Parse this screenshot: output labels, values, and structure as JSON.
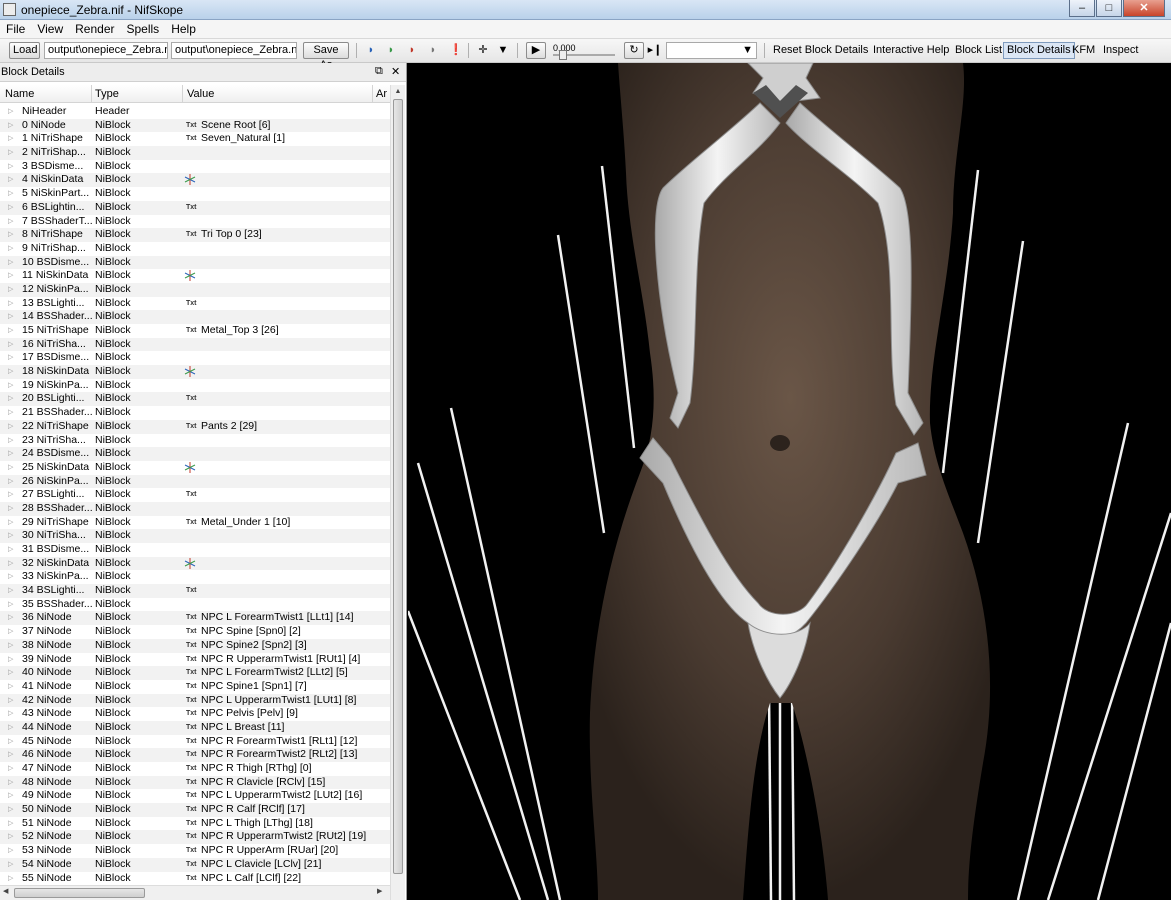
{
  "window": {
    "title": "onepiece_Zebra.nif - NifSkope",
    "min": "–",
    "max": "□",
    "close": "✕"
  },
  "menu": {
    "file": "File",
    "view": "View",
    "render": "Render",
    "spells": "Spells",
    "help": "Help"
  },
  "toolbar": {
    "load": "Load",
    "load_path": "output\\onepiece_Zebra.nif",
    "save_path": "output\\onepiece_Zebra.nif",
    "save_as": "Save As",
    "time_value": "0.000",
    "reset_block_details": "Reset Block Details",
    "interactive_help": "Interactive Help",
    "block_list": "Block List",
    "block_details": "Block Details",
    "kfm": "KFM",
    "inspect": "Inspect"
  },
  "block_details": {
    "title": "Block Details",
    "columns": {
      "name": "Name",
      "type": "Type",
      "value": "Value",
      "args": "Ar"
    },
    "rows": [
      {
        "name": "NiHeader",
        "type": "Header",
        "value": "",
        "tag": ""
      },
      {
        "name": "0 NiNode",
        "type": "NiBlock",
        "value": "Scene Root [6]",
        "tag": "Txt"
      },
      {
        "name": "1 NiTriShape",
        "type": "NiBlock",
        "value": "Seven_Natural [1]",
        "tag": "Txt"
      },
      {
        "name": "2 NiTriShap...",
        "type": "NiBlock",
        "value": "",
        "tag": ""
      },
      {
        "name": "3 BSDisme...",
        "type": "NiBlock",
        "value": "",
        "tag": ""
      },
      {
        "name": "4 NiSkinData",
        "type": "NiBlock",
        "value": "",
        "tag": "star"
      },
      {
        "name": "5 NiSkinPart...",
        "type": "NiBlock",
        "value": "",
        "tag": ""
      },
      {
        "name": "6 BSLightin...",
        "type": "NiBlock",
        "value": "",
        "tag": "Txt"
      },
      {
        "name": "7 BSShaderT...",
        "type": "NiBlock",
        "value": "",
        "tag": ""
      },
      {
        "name": "8 NiTriShape",
        "type": "NiBlock",
        "value": "Tri Top 0 [23]",
        "tag": "Txt"
      },
      {
        "name": "9 NiTriShap...",
        "type": "NiBlock",
        "value": "",
        "tag": ""
      },
      {
        "name": "10 BSDisme...",
        "type": "NiBlock",
        "value": "",
        "tag": ""
      },
      {
        "name": "11 NiSkinData",
        "type": "NiBlock",
        "value": "",
        "tag": "star"
      },
      {
        "name": "12 NiSkinPa...",
        "type": "NiBlock",
        "value": "",
        "tag": ""
      },
      {
        "name": "13 BSLighti...",
        "type": "NiBlock",
        "value": "",
        "tag": "Txt"
      },
      {
        "name": "14 BSShader...",
        "type": "NiBlock",
        "value": "",
        "tag": ""
      },
      {
        "name": "15 NiTriShape",
        "type": "NiBlock",
        "value": "Metal_Top 3 [26]",
        "tag": "Txt"
      },
      {
        "name": "16 NiTriSha...",
        "type": "NiBlock",
        "value": "",
        "tag": ""
      },
      {
        "name": "17 BSDisme...",
        "type": "NiBlock",
        "value": "",
        "tag": ""
      },
      {
        "name": "18 NiSkinData",
        "type": "NiBlock",
        "value": "",
        "tag": "star"
      },
      {
        "name": "19 NiSkinPa...",
        "type": "NiBlock",
        "value": "",
        "tag": ""
      },
      {
        "name": "20 BSLighti...",
        "type": "NiBlock",
        "value": "",
        "tag": "Txt"
      },
      {
        "name": "21 BSShader...",
        "type": "NiBlock",
        "value": "",
        "tag": ""
      },
      {
        "name": "22 NiTriShape",
        "type": "NiBlock",
        "value": "Pants 2 [29]",
        "tag": "Txt"
      },
      {
        "name": "23 NiTriSha...",
        "type": "NiBlock",
        "value": "",
        "tag": ""
      },
      {
        "name": "24 BSDisme...",
        "type": "NiBlock",
        "value": "",
        "tag": ""
      },
      {
        "name": "25 NiSkinData",
        "type": "NiBlock",
        "value": "",
        "tag": "star"
      },
      {
        "name": "26 NiSkinPa...",
        "type": "NiBlock",
        "value": "",
        "tag": ""
      },
      {
        "name": "27 BSLighti...",
        "type": "NiBlock",
        "value": "",
        "tag": "Txt"
      },
      {
        "name": "28 BSShader...",
        "type": "NiBlock",
        "value": "",
        "tag": ""
      },
      {
        "name": "29 NiTriShape",
        "type": "NiBlock",
        "value": "Metal_Under 1 [10]",
        "tag": "Txt"
      },
      {
        "name": "30 NiTriSha...",
        "type": "NiBlock",
        "value": "",
        "tag": ""
      },
      {
        "name": "31 BSDisme...",
        "type": "NiBlock",
        "value": "",
        "tag": ""
      },
      {
        "name": "32 NiSkinData",
        "type": "NiBlock",
        "value": "",
        "tag": "star"
      },
      {
        "name": "33 NiSkinPa...",
        "type": "NiBlock",
        "value": "",
        "tag": ""
      },
      {
        "name": "34 BSLighti...",
        "type": "NiBlock",
        "value": "",
        "tag": "Txt"
      },
      {
        "name": "35 BSShader...",
        "type": "NiBlock",
        "value": "",
        "tag": ""
      },
      {
        "name": "36 NiNode",
        "type": "NiBlock",
        "value": "NPC L ForearmTwist1 [LLt1] [14]",
        "tag": "Txt"
      },
      {
        "name": "37 NiNode",
        "type": "NiBlock",
        "value": "NPC Spine [Spn0] [2]",
        "tag": "Txt"
      },
      {
        "name": "38 NiNode",
        "type": "NiBlock",
        "value": "NPC Spine2 [Spn2] [3]",
        "tag": "Txt"
      },
      {
        "name": "39 NiNode",
        "type": "NiBlock",
        "value": "NPC R UpperarmTwist1 [RUt1] [4]",
        "tag": "Txt"
      },
      {
        "name": "40 NiNode",
        "type": "NiBlock",
        "value": "NPC L ForearmTwist2 [LLt2] [5]",
        "tag": "Txt"
      },
      {
        "name": "41 NiNode",
        "type": "NiBlock",
        "value": "NPC Spine1 [Spn1] [7]",
        "tag": "Txt"
      },
      {
        "name": "42 NiNode",
        "type": "NiBlock",
        "value": "NPC L UpperarmTwist1 [LUt1] [8]",
        "tag": "Txt"
      },
      {
        "name": "43 NiNode",
        "type": "NiBlock",
        "value": "NPC Pelvis [Pelv] [9]",
        "tag": "Txt"
      },
      {
        "name": "44 NiNode",
        "type": "NiBlock",
        "value": "NPC L Breast [11]",
        "tag": "Txt"
      },
      {
        "name": "45 NiNode",
        "type": "NiBlock",
        "value": "NPC R ForearmTwist1 [RLt1] [12]",
        "tag": "Txt"
      },
      {
        "name": "46 NiNode",
        "type": "NiBlock",
        "value": "NPC R ForearmTwist2 [RLt2] [13]",
        "tag": "Txt"
      },
      {
        "name": "47 NiNode",
        "type": "NiBlock",
        "value": "NPC R Thigh [RThg] [0]",
        "tag": "Txt"
      },
      {
        "name": "48 NiNode",
        "type": "NiBlock",
        "value": "NPC R Clavicle [RClv] [15]",
        "tag": "Txt"
      },
      {
        "name": "49 NiNode",
        "type": "NiBlock",
        "value": "NPC L UpperarmTwist2 [LUt2] [16]",
        "tag": "Txt"
      },
      {
        "name": "50 NiNode",
        "type": "NiBlock",
        "value": "NPC R Calf [RClf] [17]",
        "tag": "Txt"
      },
      {
        "name": "51 NiNode",
        "type": "NiBlock",
        "value": "NPC L Thigh [LThg] [18]",
        "tag": "Txt"
      },
      {
        "name": "52 NiNode",
        "type": "NiBlock",
        "value": "NPC R UpperarmTwist2 [RUt2] [19]",
        "tag": "Txt"
      },
      {
        "name": "53 NiNode",
        "type": "NiBlock",
        "value": "NPC R UpperArm [RUar] [20]",
        "tag": "Txt"
      },
      {
        "name": "54 NiNode",
        "type": "NiBlock",
        "value": "NPC L Clavicle [LClv] [21]",
        "tag": "Txt"
      },
      {
        "name": "55 NiNode",
        "type": "NiBlock",
        "value": "NPC L Calf [LClf] [22]",
        "tag": "Txt"
      }
    ]
  },
  "colors": {
    "skin": "#4a3b31",
    "background": "#000000",
    "garment": "#e6e6e6"
  }
}
